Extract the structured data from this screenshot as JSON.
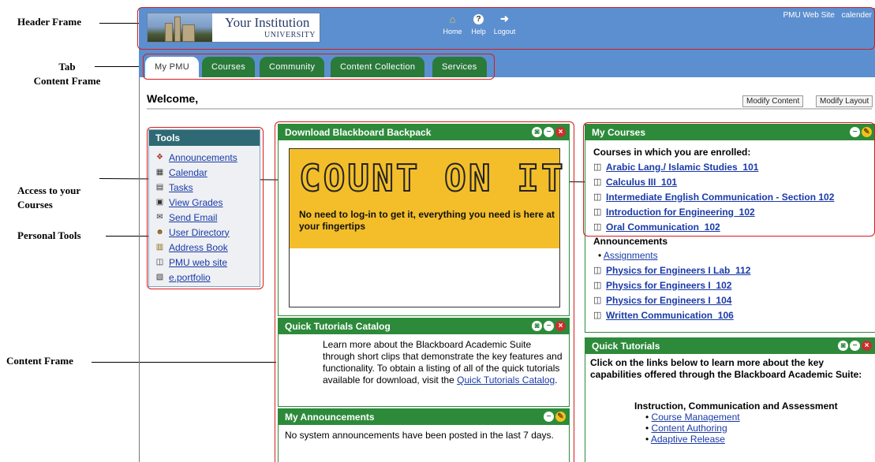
{
  "annotations": {
    "header_frame": "Header Frame",
    "tab_line1": "Tab",
    "tab_line2": "Content Frame",
    "access_line1": "Access to your",
    "access_line2": "Courses",
    "personal_tools": "Personal Tools",
    "content_frame": "Content Frame"
  },
  "header": {
    "institution_name": "Your Institution",
    "institution_sub": "UNIVERSITY",
    "icons": [
      {
        "icon": "home-icon",
        "label": "Home"
      },
      {
        "icon": "help-icon",
        "label": "Help"
      },
      {
        "icon": "logout-icon",
        "label": "Logout"
      }
    ],
    "link_site": "PMU Web Site",
    "link_calendar": "calender"
  },
  "tabs": [
    "My PMU",
    "Courses",
    "Community",
    "Content Collection",
    "Services"
  ],
  "welcome": {
    "text": "Welcome,",
    "modify_content": "Modify Content",
    "modify_layout": "Modify Layout"
  },
  "tools": {
    "title": "Tools",
    "items": [
      {
        "icon": "announcements-icon",
        "label": "Announcements"
      },
      {
        "icon": "calendar-icon",
        "label": "Calendar"
      },
      {
        "icon": "tasks-icon",
        "label": "Tasks"
      },
      {
        "icon": "grades-icon",
        "label": "View Grades"
      },
      {
        "icon": "email-icon",
        "label": "Send Email"
      },
      {
        "icon": "user-directory-icon",
        "label": "User Directory"
      },
      {
        "icon": "address-book-icon",
        "label": "Address Book"
      },
      {
        "icon": "book-icon",
        "label": "PMU web site"
      },
      {
        "icon": "portfolio-icon",
        "label": "e.portfolio"
      }
    ]
  },
  "backpack": {
    "title": "Download Blackboard Backpack",
    "promo_title": "COUNT ON IT",
    "promo_text": "No need to log-in to get it, everything you need is here at your fingertips"
  },
  "quick_catalog": {
    "title": "Quick Tutorials Catalog",
    "text": "Learn more about the Blackboard Academic Suite through short clips that demonstrate the key features and functionality. To obtain a listing of all of the quick tutorials available for download, visit the",
    "link": "Quick Tutorials Catalog",
    "end": "."
  },
  "my_announcements": {
    "title": "My Announcements",
    "text": "No system announcements have been posted in the last 7 days."
  },
  "my_courses": {
    "title": "My Courses",
    "enrolled_label": "Courses in which you are enrolled:",
    "courses_top": [
      "Arabic Lang./ Islamic Studies_101",
      "Calculus III_101",
      "Intermediate English Communication - Section 102",
      "Introduction for Engineering_102",
      "Oral Communication_102"
    ],
    "announcements_label": "Announcements",
    "announcement_link": "Assignments",
    "courses_bottom": [
      "Physics for Engineers I Lab_112",
      "Physics for Engineers I_102",
      "Physics for Engineers I_104",
      "Written Communication_106"
    ]
  },
  "quick_tutorials": {
    "title": "Quick Tutorials",
    "intro": "Click on the links below to learn more about the key capabilities offered through the Blackboard Academic Suite:",
    "section": "Instruction, Communication and Assessment",
    "links": [
      "Course Management",
      "Content Authoring",
      "Adaptive Release"
    ]
  },
  "colors": {
    "header_blue": "#5c8fcf",
    "module_green": "#2d8a3a",
    "tools_head": "#2f6a74",
    "promo_yellow": "#f3be2a",
    "annotation_red": "#d81b1b",
    "link_blue": "#1a3aa8"
  }
}
